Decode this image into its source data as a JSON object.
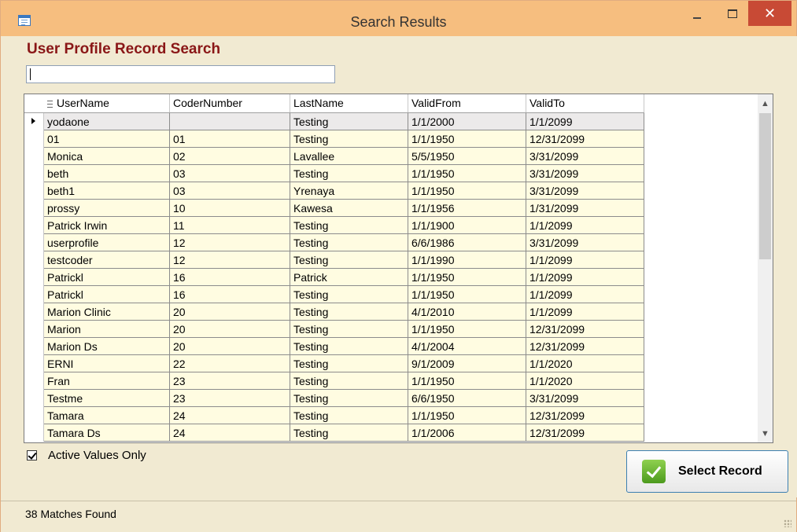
{
  "window": {
    "title": "Search Results"
  },
  "heading": "User Profile Record Search",
  "search": {
    "value": "",
    "placeholder": ""
  },
  "grid": {
    "columns": [
      "UserName",
      "CoderNumber",
      "LastName",
      "ValidFrom",
      "ValidTo"
    ],
    "rows": [
      [
        "yodaone",
        "",
        "Testing",
        "1/1/2000",
        "1/1/2099"
      ],
      [
        "01",
        "01",
        "Testing",
        "1/1/1950",
        "12/31/2099"
      ],
      [
        "Monica",
        "02",
        "Lavallee",
        "5/5/1950",
        "3/31/2099"
      ],
      [
        "beth",
        "03",
        "Testing",
        "1/1/1950",
        "3/31/2099"
      ],
      [
        "beth1",
        "03",
        "Yrenaya",
        "1/1/1950",
        "3/31/2099"
      ],
      [
        "prossy",
        "10",
        "Kawesa",
        "1/1/1956",
        "1/31/2099"
      ],
      [
        "Patrick Irwin",
        "11",
        "Testing",
        "1/1/1900",
        "1/1/2099"
      ],
      [
        "userprofile",
        "12",
        "Testing",
        "6/6/1986",
        "3/31/2099"
      ],
      [
        "testcoder",
        "12",
        "Testing",
        "1/1/1990",
        "1/1/2099"
      ],
      [
        "Patrickl",
        "16",
        "Patrick",
        "1/1/1950",
        "1/1/2099"
      ],
      [
        "Patrickl",
        "16",
        "Testing",
        "1/1/1950",
        "1/1/2099"
      ],
      [
        "Marion Clinic",
        "20",
        "Testing",
        "4/1/2010",
        "1/1/2099"
      ],
      [
        "Marion",
        "20",
        "Testing",
        "1/1/1950",
        "12/31/2099"
      ],
      [
        "Marion Ds",
        "20",
        "Testing",
        "4/1/2004",
        "12/31/2099"
      ],
      [
        "ERNI",
        "22",
        "Testing",
        "9/1/2009",
        "1/1/2020"
      ],
      [
        "Fran",
        "23",
        "Testing",
        "1/1/1950",
        "1/1/2020"
      ],
      [
        "Testme",
        "23",
        "Testing",
        "6/6/1950",
        "3/31/2099"
      ],
      [
        "Tamara",
        "24",
        "Testing",
        "1/1/1950",
        "12/31/2099"
      ],
      [
        "Tamara Ds",
        "24",
        "Testing",
        "1/1/2006",
        "12/31/2099"
      ]
    ],
    "selected_row": 0
  },
  "active_only": {
    "label": "Active Values Only",
    "checked": true
  },
  "select_button": {
    "label": "Select Record",
    "icon": "checkmark-icon",
    "color": "#5fb32a"
  },
  "status": {
    "text": "38 Matches Found"
  },
  "colors": {
    "heading": "#8a1717",
    "row_bg": "#fffce1",
    "titlebar": "#f6be7f",
    "close": "#c84a35"
  }
}
